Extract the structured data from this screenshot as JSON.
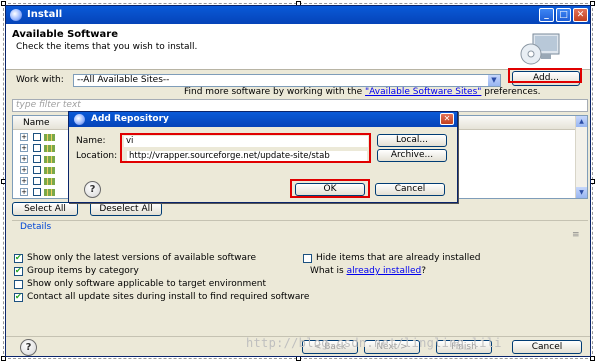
{
  "window": {
    "title": "Install"
  },
  "header": {
    "title": "Available Software",
    "subtitle": "Check the items that you wish to install."
  },
  "work_with": {
    "label": "Work with:",
    "value": "--All Available Sites--",
    "add_label": "Add...",
    "hint_prefix": "Find more software by working with the ",
    "hint_link": "\"Available Software Sites\"",
    "hint_suffix": " preferences."
  },
  "filter": {
    "placeholder": "type filter text"
  },
  "tree": {
    "column_name": "Name",
    "row_count": 7
  },
  "buttons": {
    "select_all": "Select All",
    "deselect_all": "Deselect All"
  },
  "details": {
    "label": "Details",
    "options": [
      {
        "label": "Show only the latest versions of available software",
        "checked": true
      },
      {
        "label": "Group items by category",
        "checked": true
      },
      {
        "label": "Show only software applicable to target environment",
        "checked": false
      },
      {
        "label": "Contact all update sites during install to find required software",
        "checked": true
      },
      {
        "label": "Hide items that are already installed",
        "checked": false
      }
    ],
    "what_is_prefix": "What is ",
    "what_is_link": "already installed",
    "what_is_suffix": "?"
  },
  "footer": {
    "back": "< Back",
    "next": "Next >",
    "finish": "Finish",
    "cancel": "Cancel"
  },
  "dialog": {
    "title": "Add Repository",
    "name_label": "Name:",
    "name_value": "vi",
    "location_label": "Location:",
    "location_value": "http://vrapper.sourceforge.net/update-site/stab",
    "local_label": "Local...",
    "archive_label": "Archive...",
    "ok_label": "OK",
    "cancel_label": "Cancel"
  },
  "watermark": "http://blog.csdn.net/lingling_lili",
  "colors": {
    "highlight_red": "#e00000",
    "titlebar_blue": "#0a5ad8",
    "link_blue": "#0000ee"
  }
}
